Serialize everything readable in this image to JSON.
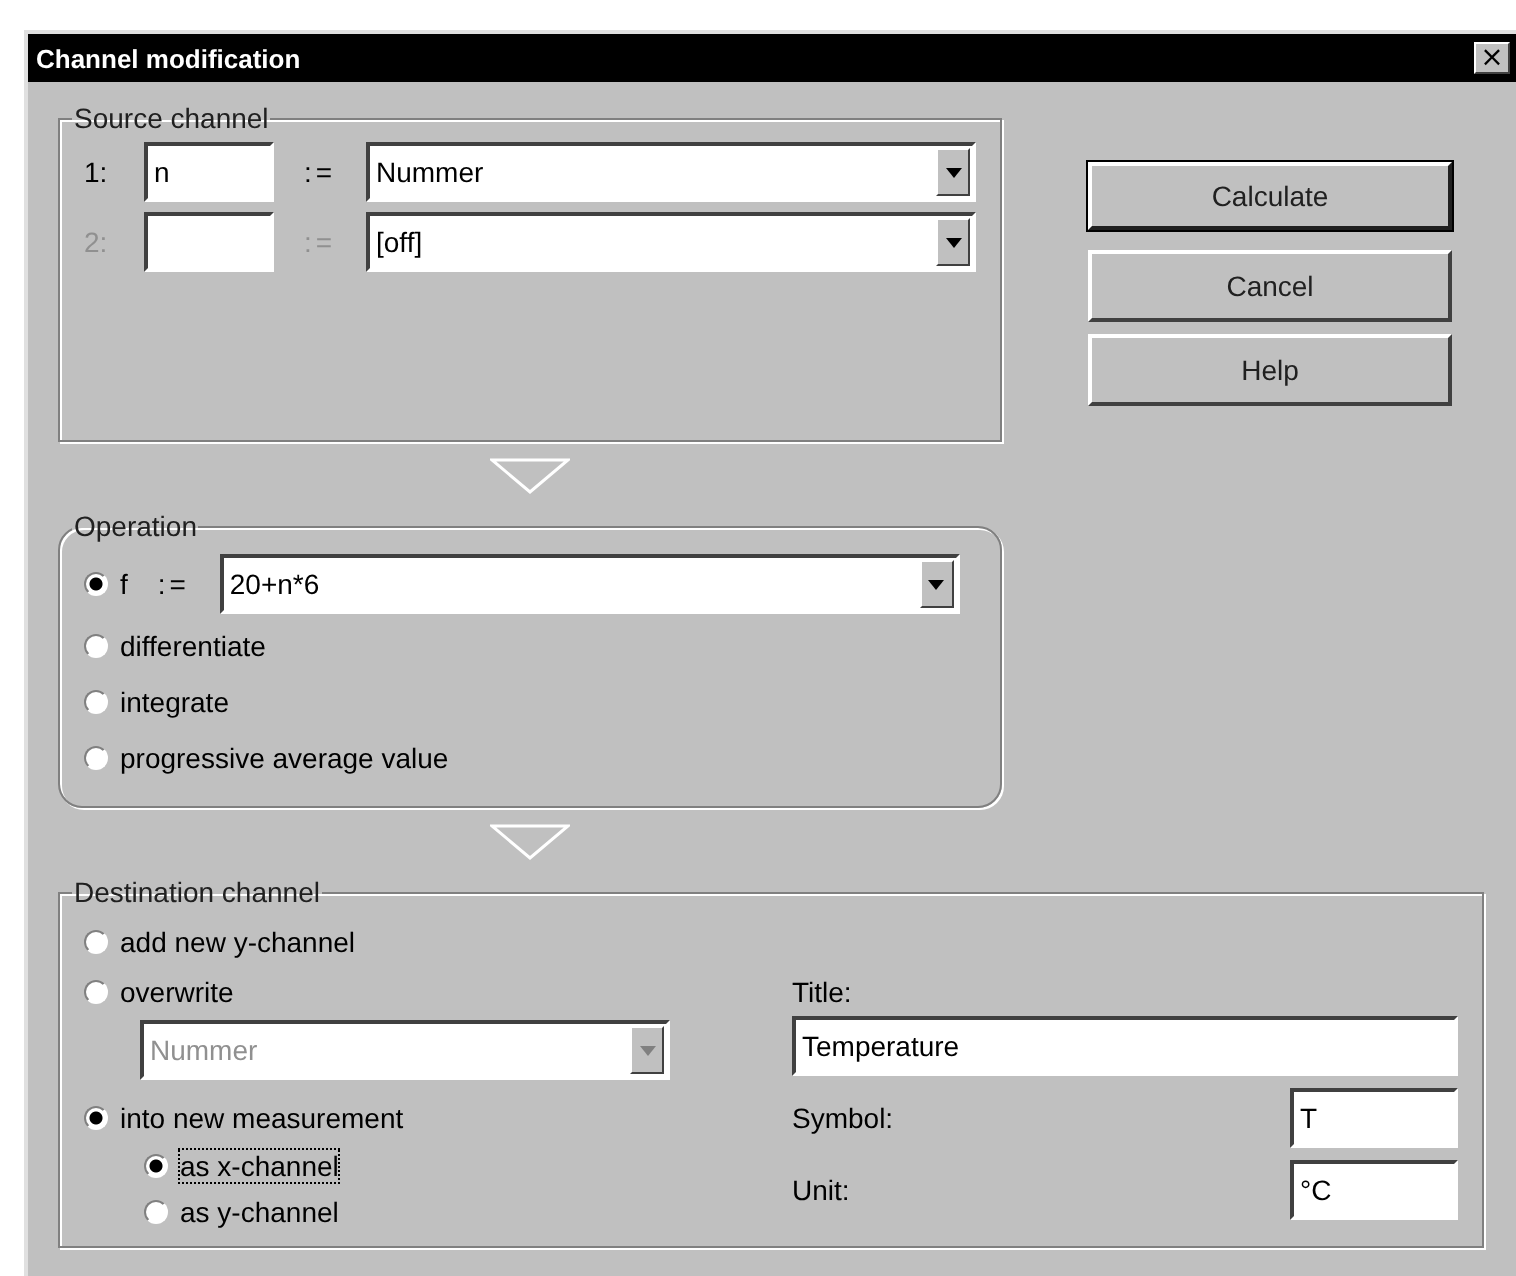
{
  "window": {
    "title": "Channel modification",
    "close": "×"
  },
  "source_channel": {
    "title": "Source channel",
    "rows": [
      {
        "index": "1:",
        "name": "n",
        "assign": ":=",
        "value": "Nummer",
        "disabled": false
      },
      {
        "index": "2:",
        "assign": ":=",
        "value": "[off]",
        "disabled": true
      }
    ]
  },
  "operation": {
    "title": "Operation",
    "options": [
      {
        "kind": "formula",
        "label": "f",
        "assign": ":=",
        "value": "20+n*6",
        "selected": true
      },
      {
        "kind": "plain",
        "label": "differentiate",
        "selected": false
      },
      {
        "kind": "plain",
        "label": "integrate",
        "selected": false
      },
      {
        "kind": "plain",
        "label": "progressive average value",
        "selected": false
      }
    ]
  },
  "destination": {
    "title": "Destination channel",
    "options": [
      {
        "kind": "plain",
        "label": "add new y-channel",
        "selected": false
      },
      {
        "kind": "combo",
        "label": "overwrite",
        "selected": false,
        "combo": {
          "value": "Nummer",
          "disabled": true
        }
      },
      {
        "kind": "group",
        "label": "into new measurement",
        "selected": true,
        "children": [
          {
            "label": "as x-channel",
            "selected": true,
            "focused": true
          },
          {
            "label": "as y-channel",
            "selected": false,
            "focused": false
          }
        ]
      }
    ],
    "fields": [
      {
        "kind": "wide",
        "label": "Title:",
        "value": "Temperature"
      },
      {
        "kind": "short",
        "label": "Symbol:",
        "value": "T"
      },
      {
        "kind": "short",
        "label": "Unit:",
        "value": "°C"
      }
    ]
  },
  "buttons": [
    {
      "label": "Calculate",
      "default": true
    },
    {
      "label": "Cancel",
      "default": false
    },
    {
      "label": "Help",
      "default": false
    }
  ]
}
